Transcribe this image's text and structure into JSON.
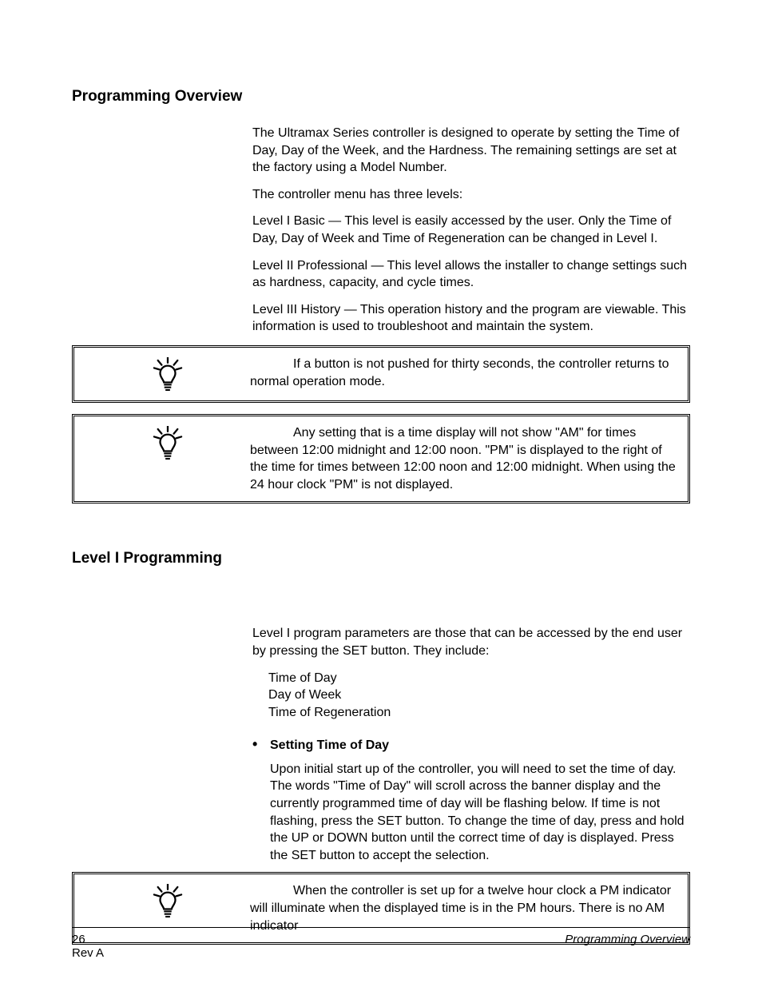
{
  "section1": {
    "heading": "Programming Overview",
    "p1": "The Ultramax Series controller is designed to operate by setting the Time of Day, Day of the Week, and the Hardness. The remaining settings are set at the factory using a Model Number.",
    "p2": "The controller menu has three levels:",
    "p3": "Level I Basic — This level is easily accessed by the user. Only the Time of Day, Day of Week and Time of Regeneration can be changed in Level I.",
    "p4": "Level II Professional — This level allows the installer to change settings such as hardness, capacity, and cycle times.",
    "p5": "Level III History — This operation history and the program are viewable. This information is used to troubleshoot and maintain the system."
  },
  "note1": "If a button is not pushed for thirty seconds, the controller returns to normal operation mode.",
  "note2": "Any setting that is a time display will not show \"AM\" for times between 12:00 midnight and 12:00 noon. \"PM\" is displayed to the right of the time for times between 12:00 noon and 12:00 midnight. When using the 24 hour clock \"PM\" is not displayed.",
  "section2": {
    "heading": "Level I Programming",
    "intro": "Level I program parameters are those that can be accessed by the end user by pressing the SET button. They include:",
    "items": {
      "a": "Time of Day",
      "b": "Day of Week",
      "c": "Time of Regeneration"
    },
    "sub_heading": "Setting Time of Day",
    "sub_body": "Upon initial start up of the controller, you will need to set the time of day. The words \"Time of Day\" will scroll across the banner display and the currently programmed time of day will be flashing below. If time is not flashing, press the SET button. To change the time of day, press and hold the UP or DOWN button until the correct time of day is displayed. Press the SET button to accept the selection."
  },
  "note3": "When the controller is set up for a twelve hour clock a PM indicator will illuminate when the displayed time is in the PM hours. There is no AM indicator",
  "footer": {
    "page": "26",
    "rev": "Rev A",
    "title": "Programming Overview"
  }
}
